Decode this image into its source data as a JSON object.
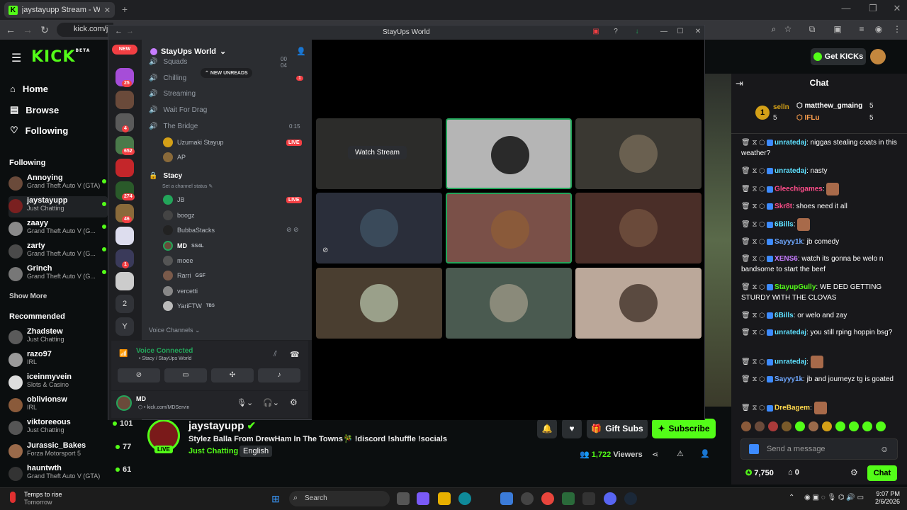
{
  "browser": {
    "tab_title": "jaystayupp Stream - Watch Live",
    "url": "kick.com/ja",
    "new_tab": "+",
    "minimize": "—",
    "maximize": "❐",
    "close": "✕"
  },
  "kick": {
    "logo": "KICK",
    "logo_sup": "BETA",
    "nav": [
      {
        "icon": "home-icon",
        "label": "Home"
      },
      {
        "icon": "browse-icon",
        "label": "Browse"
      },
      {
        "icon": "heart-icon",
        "label": "Following"
      }
    ],
    "following_header": "Following",
    "following": [
      {
        "name": "Annoying",
        "category": "Grand Theft Auto V (GTA)"
      },
      {
        "name": "jaystayupp",
        "category": "Just Chatting"
      },
      {
        "name": "zaayy",
        "category": "Grand Theft Auto V (G..."
      },
      {
        "name": "zarty",
        "category": "Grand Theft Auto V (G..."
      },
      {
        "name": "Grinch",
        "category": "Grand Theft Auto V (G..."
      }
    ],
    "show_more": "Show More",
    "recommended_header": "Recommended",
    "recommended": [
      {
        "name": "Zhadstew",
        "category": "Just Chatting",
        "viewers": ""
      },
      {
        "name": "razo97",
        "category": "IRL",
        "viewers": ""
      },
      {
        "name": "iceinmyvein",
        "category": "Slots & Casino",
        "viewers": ""
      },
      {
        "name": "oblivionsw",
        "category": "IRL",
        "viewers": "1"
      },
      {
        "name": "viktoreeous",
        "category": "Just Chatting",
        "viewers": "101"
      },
      {
        "name": "Jurassic_Bakes",
        "category": "Forza Motorsport 5",
        "viewers": "77"
      },
      {
        "name": "hauntwth",
        "category": "Grand Theft Auto V (GTA)",
        "viewers": "61"
      }
    ],
    "get_kicks": "Get KICKs"
  },
  "chat": {
    "title": "Chat",
    "leaders": [
      {
        "rank": "1",
        "name": "selln",
        "count": "5"
      },
      {
        "name": "matthew_gmaing",
        "count": "5"
      },
      {
        "name": "IFLu",
        "count": "5"
      }
    ],
    "messages": [
      {
        "user": "unratedaj",
        "color": "#5ee0ff",
        "text": "niggas stealing coats in this weather?"
      },
      {
        "user": "unratedaj",
        "color": "#5ee0ff",
        "text": "nasty"
      },
      {
        "user": "Gleechigames",
        "color": "#ff4d8a",
        "text": ""
      },
      {
        "user": "Skr8t",
        "color": "#ff4d8a",
        "text": "shoes need it all"
      },
      {
        "user": "6Bills",
        "color": "#5ee0ff",
        "text": ""
      },
      {
        "user": "Sayyy1k",
        "color": "#6fa8ff",
        "text": "jb comedy"
      },
      {
        "user": "XENS6",
        "color": "#c77dff",
        "text": "watch its gonna be welo n bandsome to start the beef"
      },
      {
        "user": "StayupGully",
        "color": "#53fc18",
        "text": "WE DED GETTING STURDY WITH THE CLOVAS"
      },
      {
        "user": "6Bills",
        "color": "#5ee0ff",
        "text": "or welo and zay"
      },
      {
        "user": "unratedaj",
        "color": "#5ee0ff",
        "text": "you still rping hoppin bsg?"
      },
      {
        "user": "unratedaj",
        "color": "#5ee0ff",
        "text": ""
      },
      {
        "user": "Sayyy1k",
        "color": "#6fa8ff",
        "text": "jb and journeyz tg is goated"
      },
      {
        "user": "DreBagem",
        "color": "#ffd84d",
        "text": ""
      }
    ],
    "input_placeholder": "Send a message",
    "points": "7,750",
    "drops": "0",
    "send_label": "Chat"
  },
  "stream": {
    "streamer": "jaystayupp",
    "live": "LIVE",
    "title": "Stylez Balla From DrewHam In The Towns🎋 !discord !shuffle !socials",
    "category": "Just Chatting",
    "language": "English",
    "gift_subs": "Gift Subs",
    "subscribe": "Subscribe",
    "viewers_count": "1,722",
    "viewers_label": "Viewers"
  },
  "discord": {
    "window_title": "StayUps World",
    "new_badge": "NEW",
    "server_name": "StayUps World",
    "new_unreads": "NEW UNREADS",
    "guild_badges": [
      "25",
      "4",
      "652",
      "274",
      "46",
      "1"
    ],
    "guild_letters": [
      "2",
      "Y"
    ],
    "channels": [
      {
        "name": "Squads",
        "extra": "00 04"
      },
      {
        "name": "Chilling",
        "extra": "1"
      },
      {
        "name": "Streaming",
        "extra": ""
      },
      {
        "name": "Wait For Drag",
        "extra": ""
      },
      {
        "name": "The Bridge",
        "extra": "0:15"
      }
    ],
    "bridge_users": [
      {
        "name": "Uzumaki Stayup",
        "live": "LIVE"
      },
      {
        "name": "AP",
        "live": ""
      }
    ],
    "current_channel": "Stacy",
    "set_status": "Set a channel status",
    "stacy_users": [
      {
        "name": "JB",
        "tag": "",
        "live": "LIVE"
      },
      {
        "name": "boogz",
        "tag": "",
        "live": ""
      },
      {
        "name": "BubbaStacks",
        "tag": "",
        "live": ""
      },
      {
        "name": "MD",
        "tag": "SS4L",
        "live": ""
      },
      {
        "name": "moee",
        "tag": "",
        "live": ""
      },
      {
        "name": "Rarri",
        "tag": "GSF",
        "live": ""
      },
      {
        "name": "vercetti",
        "tag": "",
        "live": ""
      },
      {
        "name": "YariFTW",
        "tag": "TBS",
        "live": ""
      }
    ],
    "voice_channels_label": "Voice Channels",
    "voice_connected": "Voice Connected",
    "voice_location": "Stacy / StayUps World",
    "user_name": "MD",
    "user_status": "kick.com/MDServin",
    "watch_stream": "Watch Stream"
  },
  "taskbar": {
    "weather_title": "Temps to rise",
    "weather_sub": "Tomorrow",
    "search": "Search",
    "time": "9:07 PM",
    "date": "2/6/2026"
  },
  "colors": {
    "kick_green": "#53fc18",
    "discord_bg": "#2b2d31",
    "live_red": "#f23f43",
    "voice_green": "#23a55a"
  }
}
